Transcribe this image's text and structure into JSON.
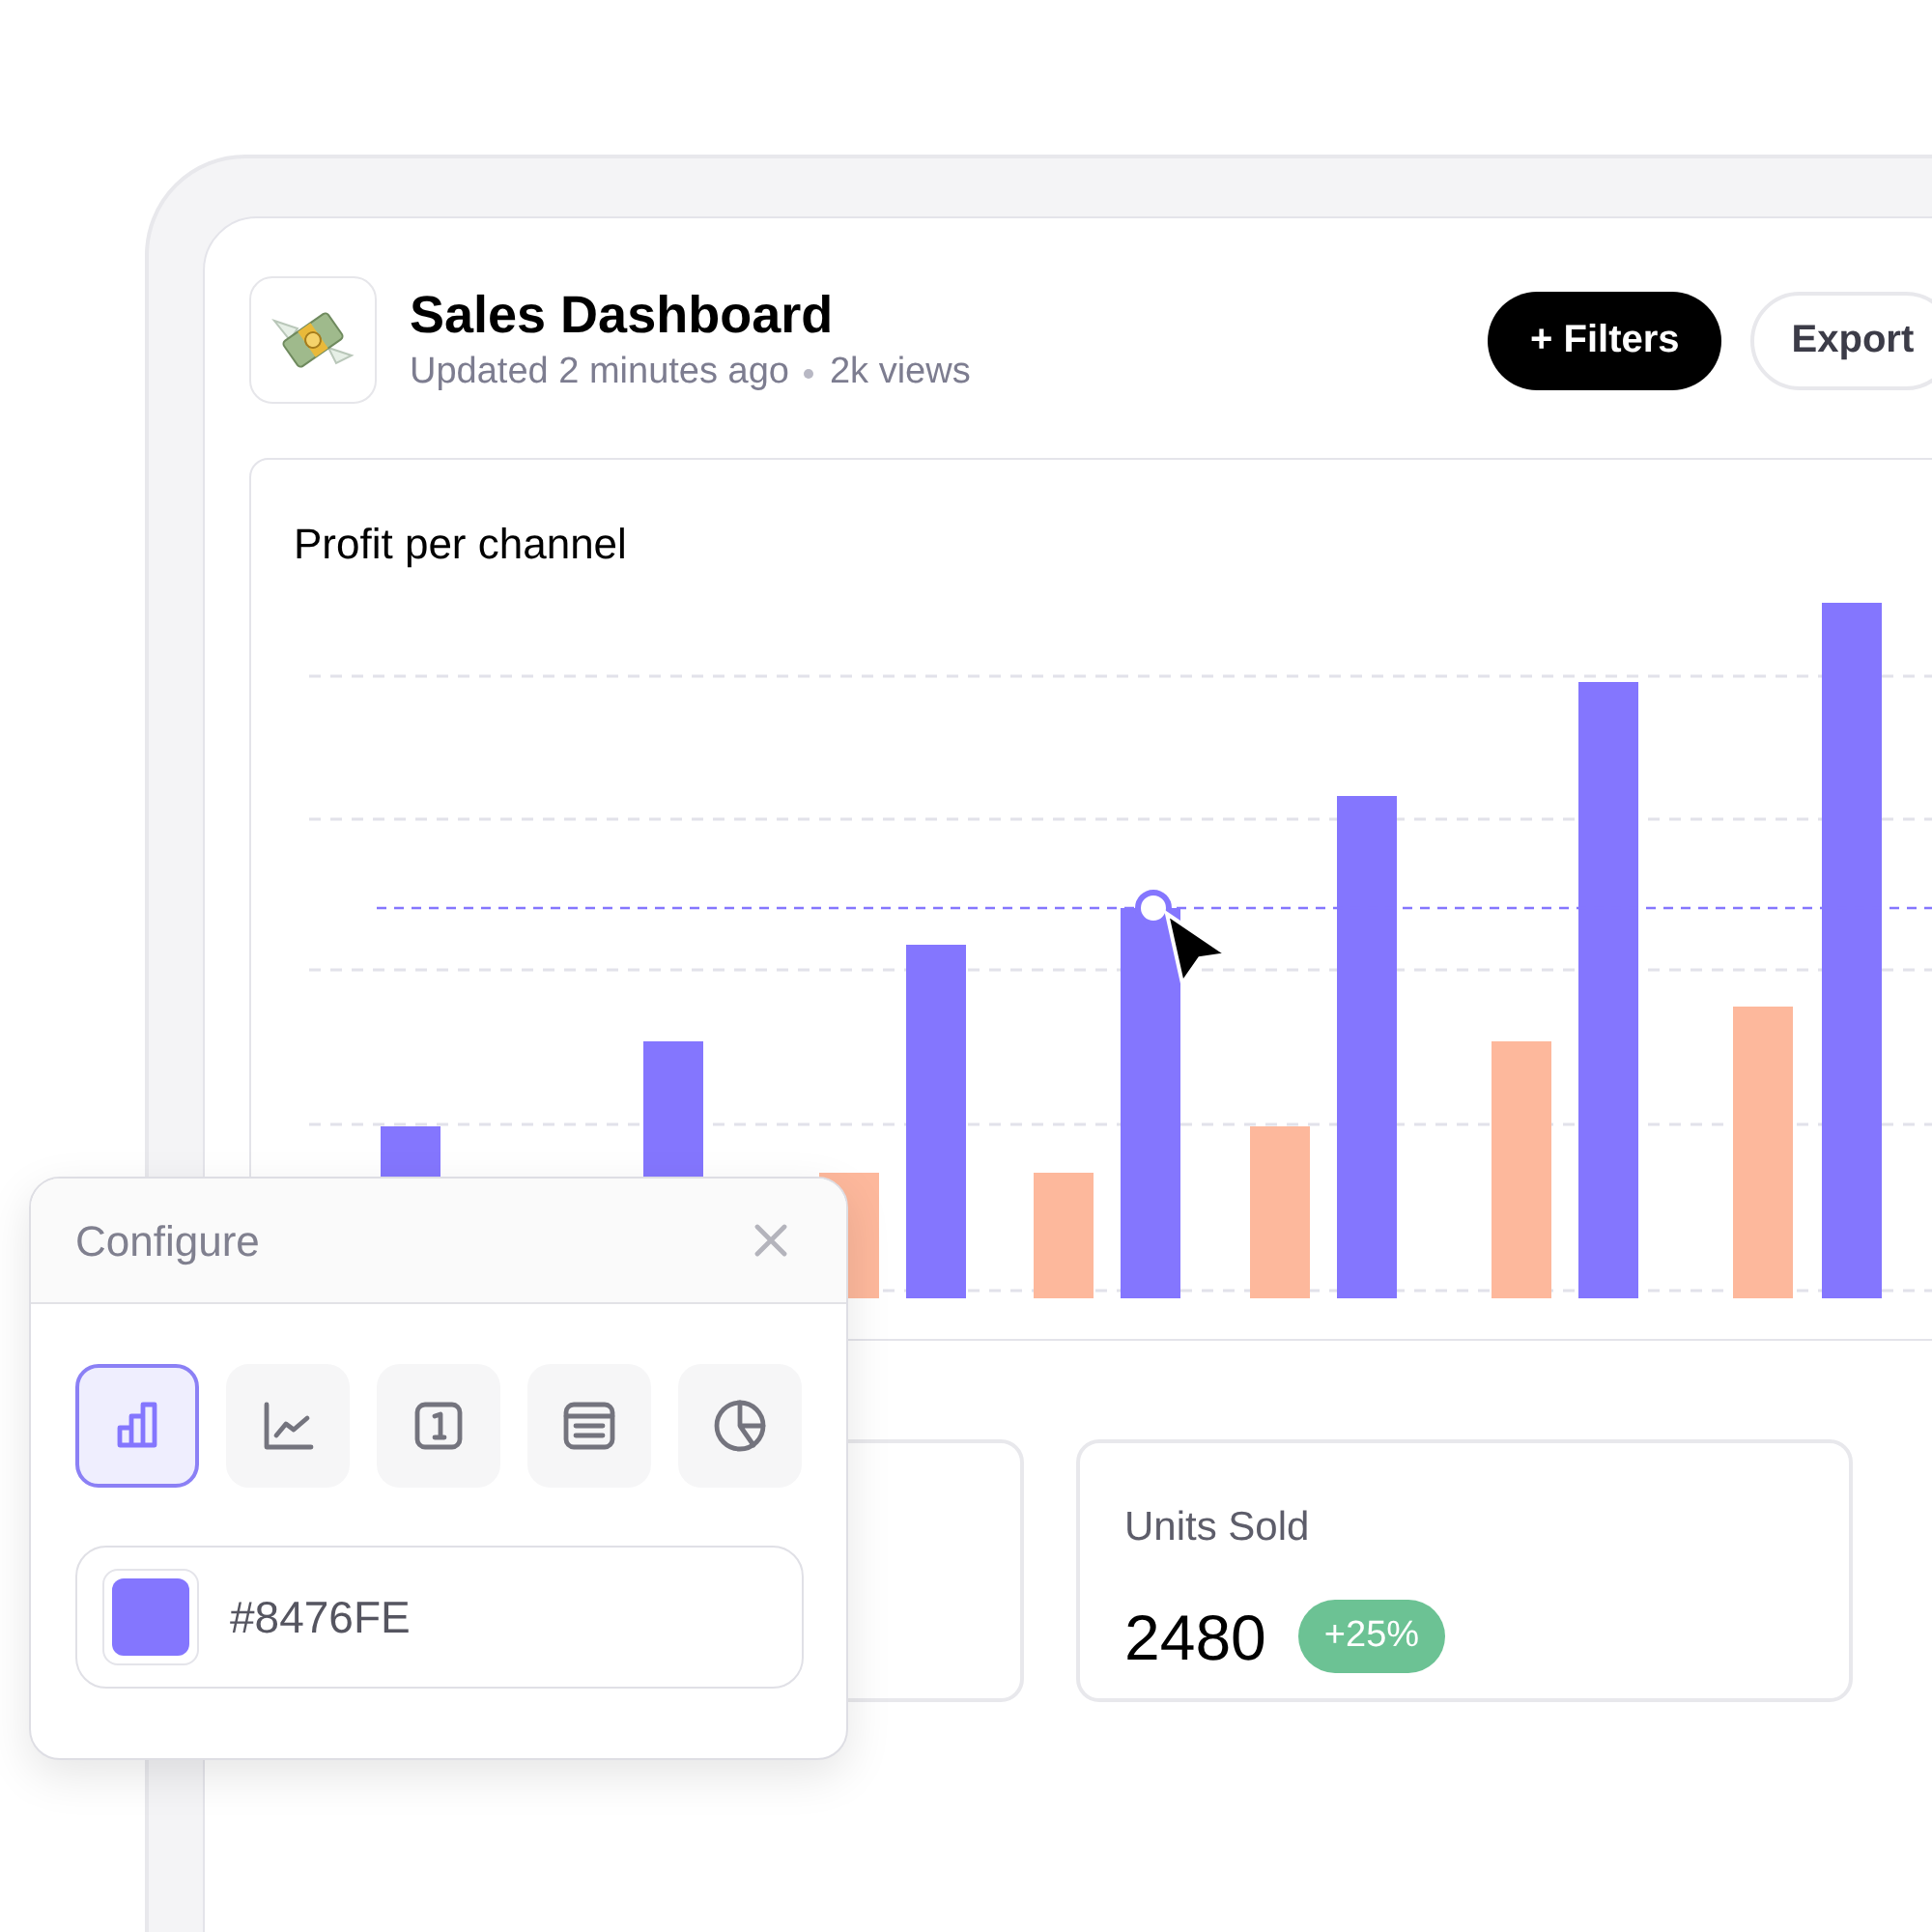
{
  "header": {
    "title": "Sales Dashboard",
    "meta": [
      "Updated 2 minutes ago",
      "2k views"
    ]
  },
  "actions": [
    {
      "label": "+ Filters",
      "kind": "primary"
    },
    {
      "label": "Export",
      "kind": "secondary"
    }
  ],
  "chart_card": {
    "title": "Profit per channel"
  },
  "stats": [
    {
      "label": "Units Sold",
      "value": "2480",
      "change": "+25%"
    }
  ],
  "configure": {
    "title": "Configure",
    "chart_types": [
      {
        "kind": "bar",
        "selected": true
      },
      {
        "kind": "line",
        "selected": false
      },
      {
        "kind": "number",
        "selected": false
      },
      {
        "kind": "table",
        "selected": false
      },
      {
        "kind": "pie",
        "selected": false
      }
    ],
    "color": {
      "value": "#8476FE"
    }
  }
}
